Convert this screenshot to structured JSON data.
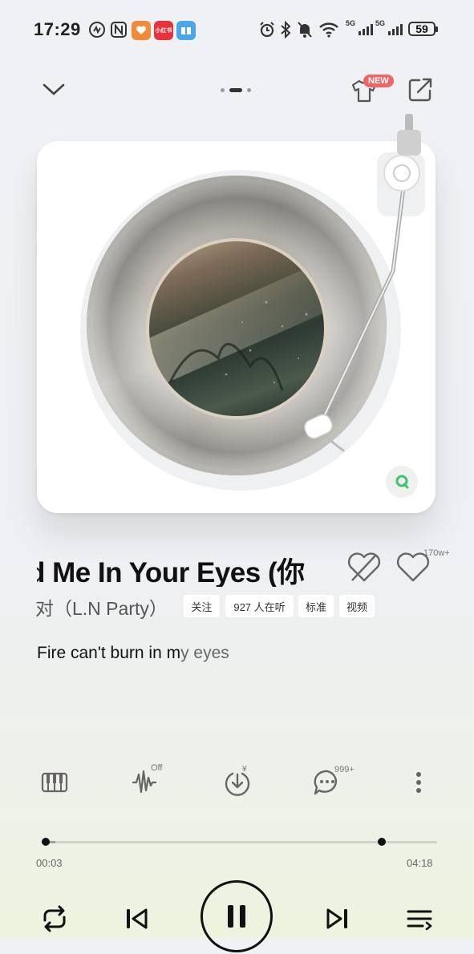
{
  "status_bar": {
    "time": "17:29",
    "app_icons": [
      {
        "name": "rhythm-app-icon",
        "color": "#3a3a3a"
      },
      {
        "name": "nfc-icon",
        "color": "#3a3a3a"
      },
      {
        "name": "heart-app-icon",
        "color": "#f28a3a"
      },
      {
        "name": "xiaohongshu-icon",
        "color": "#e8323b",
        "text": "小红书"
      },
      {
        "name": "book-app-icon",
        "color": "#4aa6e8"
      }
    ],
    "network": [
      "5G",
      "5G"
    ],
    "battery": "59"
  },
  "top_bar": {
    "new_badge": "NEW"
  },
  "player": {
    "title": "Find Me In Your Eyes (你",
    "artist": "对（L.N Party）",
    "chips": [
      "关注",
      "927 人在听",
      "标准",
      "视频"
    ],
    "like_count": "170w+",
    "lyric_main": "Fire can't burn in m",
    "lyric_fade": "y eyes"
  },
  "toolbar": {
    "effect_state": "Off",
    "download_price": "¥",
    "comment_count": "999+"
  },
  "progress": {
    "elapsed": "00:03",
    "total": "04:18",
    "fraction": 0.012,
    "buffered_marker_fraction": 0.86
  },
  "colors": {
    "new_badge": "#f06465",
    "q_badge": "#3ec46d",
    "accent": "#111111"
  }
}
